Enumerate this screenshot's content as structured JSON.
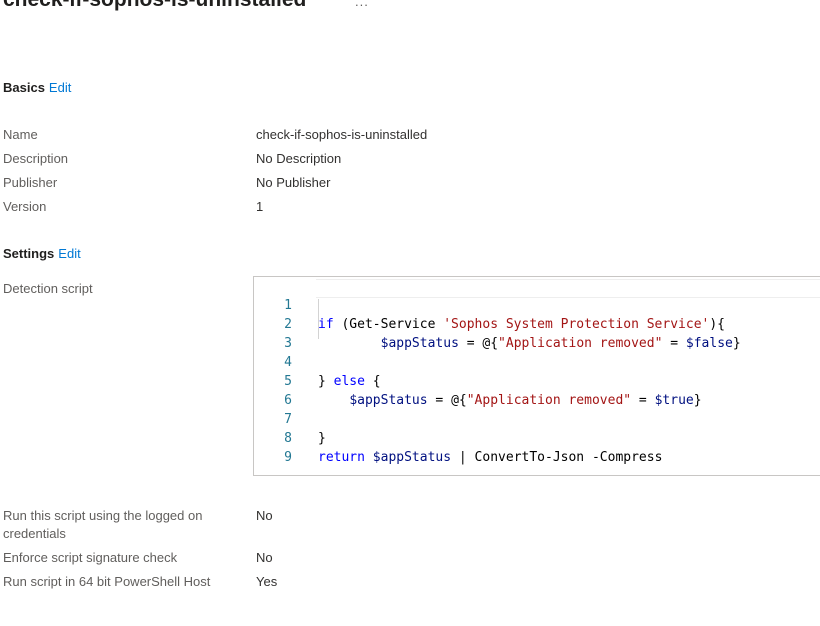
{
  "page": {
    "title": "check-if-sophos-is-uninstalled",
    "more": "..."
  },
  "basics": {
    "heading": "Basics",
    "edit": "Edit",
    "rows": [
      {
        "label": "Name",
        "value": "check-if-sophos-is-uninstalled"
      },
      {
        "label": "Description",
        "value": "No Description"
      },
      {
        "label": "Publisher",
        "value": "No Publisher"
      },
      {
        "label": "Version",
        "value": "1"
      }
    ]
  },
  "settings": {
    "heading": "Settings",
    "edit": "Edit",
    "detection_label": "Detection script",
    "script": {
      "line_numbers": [
        "1",
        "2",
        "3",
        "4",
        "5",
        "6",
        "7",
        "8",
        "9"
      ],
      "l1": {
        "kw": "if",
        "a": " (Get-Service ",
        "str": "'Sophos System Protection Service'",
        "b": "){"
      },
      "l2": {
        "indent": "        ",
        "var": "$appStatus",
        "a": " = @{",
        "str": "\"Application removed\"",
        "b": " = ",
        "var2": "$false",
        "c": "}"
      },
      "l4": {
        "a": "} ",
        "kw": "else",
        "b": " {"
      },
      "l5": {
        "indent": "    ",
        "var": "$appStatus",
        "a": " = @{",
        "str": "\"Application removed\"",
        "b": " = ",
        "var2": "$true",
        "c": "}"
      },
      "l7": {
        "a": "}"
      },
      "l8": {
        "kw": "return",
        "a": " ",
        "var": "$appStatus",
        "b": " | ConvertTo-Json -Compress"
      }
    },
    "rows": [
      {
        "label": "Run this script using the logged on credentials",
        "value": "No"
      },
      {
        "label": "Enforce script signature check",
        "value": "No"
      },
      {
        "label": "Run script in 64 bit PowerShell Host",
        "value": "Yes"
      }
    ]
  }
}
